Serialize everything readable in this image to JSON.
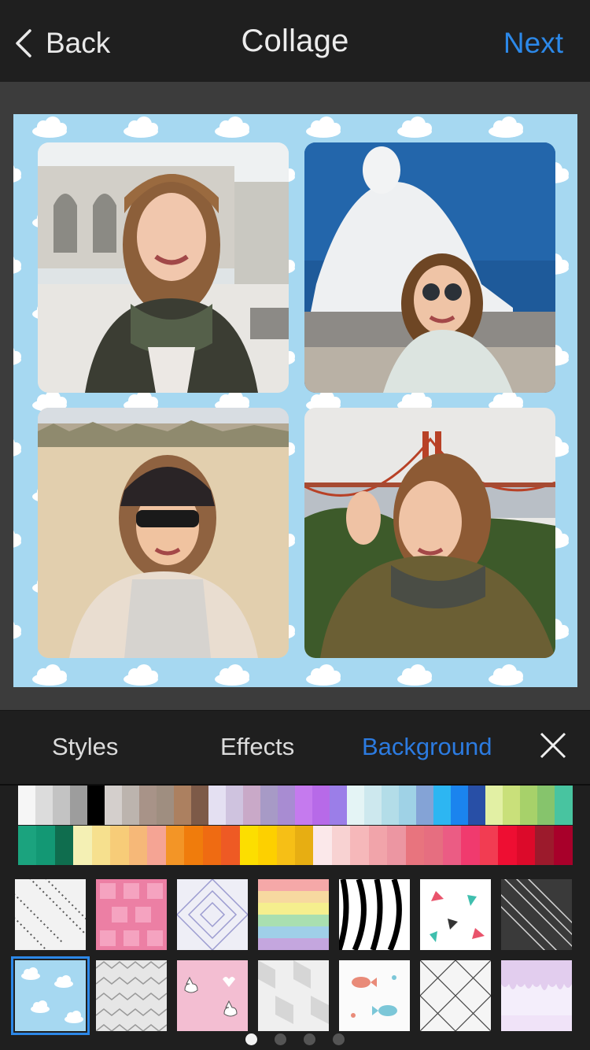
{
  "nav": {
    "back_label": "Back",
    "title": "Collage",
    "next_label": "Next"
  },
  "tabs": [
    {
      "label": "Styles",
      "active": false
    },
    {
      "label": "Effects",
      "active": false
    },
    {
      "label": "Background",
      "active": true
    }
  ],
  "collage": {
    "background_pattern": "blue-clouds",
    "background_color": "#a6d8f1",
    "photos": [
      {
        "name": "photo-taj-mahal",
        "scene": "woman selfie in front of white marble building"
      },
      {
        "name": "photo-big-buddha",
        "scene": "woman with sunglasses in front of white buddha statue"
      },
      {
        "name": "photo-beach",
        "scene": "woman with cap on sandy beach"
      },
      {
        "name": "photo-golden-gate",
        "scene": "woman waving in front of golden gate bridge"
      }
    ]
  },
  "palette": {
    "row1": [
      "#f6f6f6",
      "#dcdcdc",
      "#c3c3c3",
      "#9d9d9d",
      "#000000",
      "#d4cfcc",
      "#bcb4ae",
      "#a89388",
      "#9f8e80",
      "#ac8060",
      "#7d5a48",
      "#e4e0f2",
      "#cfc3df",
      "#c9a9c8",
      "#a79ac6",
      "#a88cd2",
      "#c57aee",
      "#b76ae8",
      "#9b7ee8",
      "#e4f4f5",
      "#cde8ee",
      "#b3dde8",
      "#9fd2e6",
      "#84a3d6",
      "#2db6f2",
      "#1b84ee",
      "#284fa6",
      "#e2f0a4",
      "#c9e07a",
      "#a7d16a",
      "#86c46c",
      "#48c4a0"
    ],
    "row2": [
      "#1ba37e",
      "#139874",
      "#0f6d4e",
      "#f4f0b4",
      "#f6e08e",
      "#f7cc78",
      "#f6b878",
      "#f5a494",
      "#f39526",
      "#f07c0c",
      "#ef6b12",
      "#ee5a24",
      "#fcde00",
      "#fdd000",
      "#f6bf16",
      "#e7ae12",
      "#fbe8ea",
      "#f8d2d2",
      "#f6b8ba",
      "#f1a4aa",
      "#ec96a2",
      "#e8747e",
      "#e66e80",
      "#eb5c84",
      "#f03a6e",
      "#f23c52",
      "#ee0e32",
      "#dc0a2a",
      "#9c1a2c",
      "#a8002a"
    ]
  },
  "patterns": [
    {
      "name": "pattern-diagonal-dots",
      "selected": false
    },
    {
      "name": "pattern-pink-tiles",
      "selected": false
    },
    {
      "name": "pattern-lilac-diamonds",
      "selected": false
    },
    {
      "name": "pattern-rainbow-stripes",
      "selected": false
    },
    {
      "name": "pattern-zebra",
      "selected": false
    },
    {
      "name": "pattern-triangles",
      "selected": false
    },
    {
      "name": "pattern-gray-diagonals",
      "selected": false
    },
    {
      "name": "pattern-blue-clouds",
      "selected": true
    },
    {
      "name": "pattern-herringbone",
      "selected": false
    },
    {
      "name": "pattern-pink-cats",
      "selected": false
    },
    {
      "name": "pattern-white-cubes",
      "selected": false
    },
    {
      "name": "pattern-fish",
      "selected": false
    },
    {
      "name": "pattern-gray-lattice",
      "selected": false
    },
    {
      "name": "pattern-lavender-drip",
      "selected": false
    }
  ],
  "pagination": {
    "pages": 4,
    "current": 1
  }
}
